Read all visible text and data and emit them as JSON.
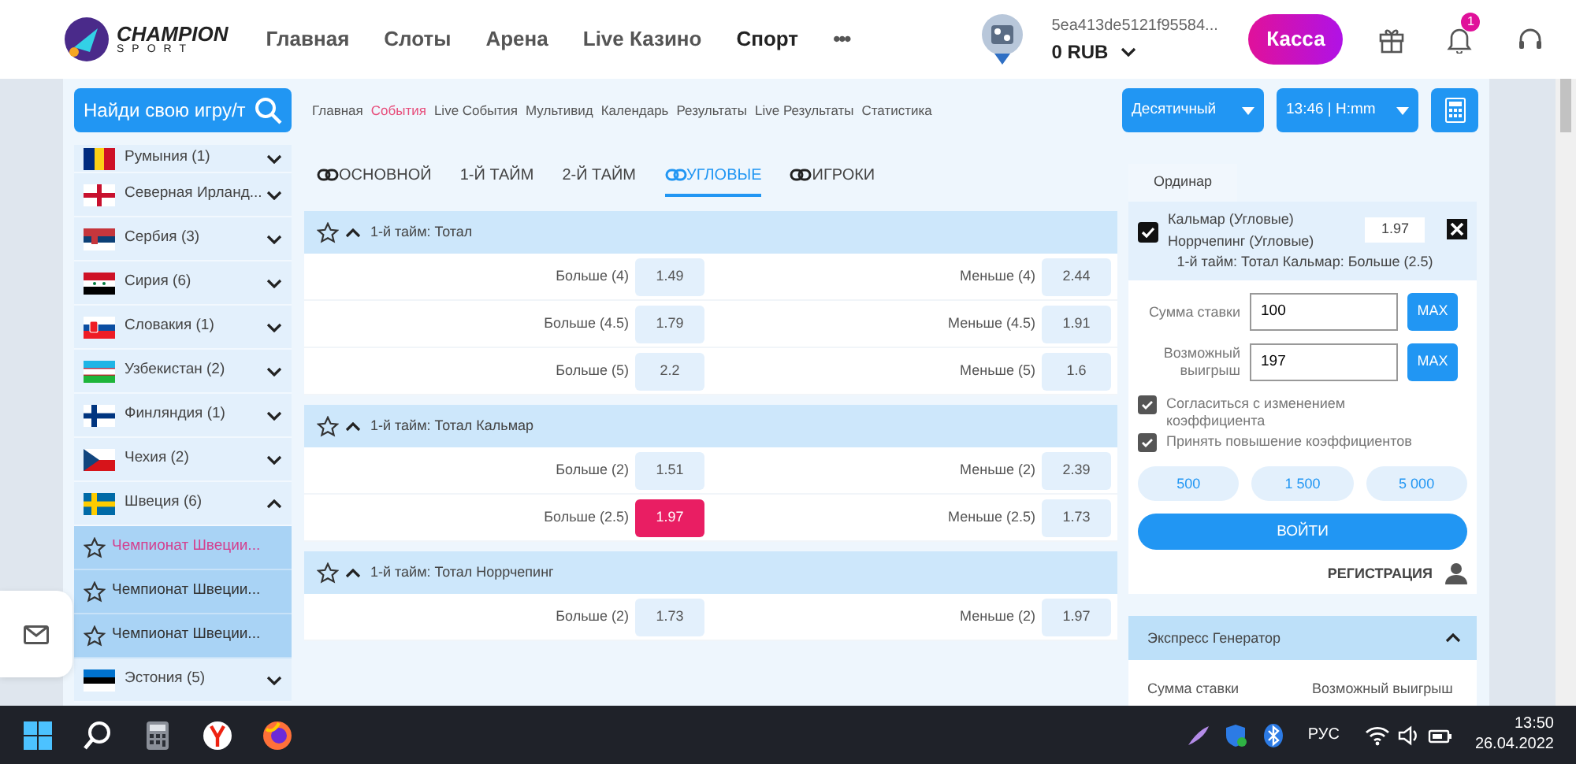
{
  "header": {
    "logo": {
      "title": "CHAMPION",
      "subtitle": "SPORT"
    },
    "nav": [
      {
        "label": "Главная",
        "selected": false
      },
      {
        "label": "Слоты",
        "selected": false
      },
      {
        "label": "Арена",
        "selected": false
      },
      {
        "label": "Live Казино",
        "selected": false
      },
      {
        "label": "Спорт",
        "selected": true
      }
    ],
    "more": "•••",
    "account": {
      "id": "5ea413de5121f95584...",
      "balance": "0 RUB"
    },
    "cashier": "Касса",
    "notifications": "1"
  },
  "subbar": {
    "search": "Найди свою игру/т",
    "links": [
      {
        "label": "Главная",
        "selected": false
      },
      {
        "label": "События",
        "selected": true
      },
      {
        "label": "Live События",
        "selected": false
      },
      {
        "label": "Мультивид",
        "selected": false
      },
      {
        "label": "Календарь",
        "selected": false
      },
      {
        "label": "Результаты",
        "selected": false
      },
      {
        "label": "Live Результаты",
        "selected": false
      },
      {
        "label": "Статистика",
        "selected": false
      }
    ],
    "odds_format": "Десятичный",
    "time_format": "13:46 | H:mm"
  },
  "sidebar": {
    "items": [
      {
        "label": "Румыния (1)",
        "expanded": false
      },
      {
        "label": "Северная Ирланд...",
        "expanded": false
      },
      {
        "label": "Сербия (3)",
        "expanded": false
      },
      {
        "label": "Сирия (6)",
        "expanded": false
      },
      {
        "label": "Словакия (1)",
        "expanded": false
      },
      {
        "label": "Узбекистан (2)",
        "expanded": false
      },
      {
        "label": "Финляндия (1)",
        "expanded": false
      },
      {
        "label": "Чехия (2)",
        "expanded": false
      },
      {
        "label": "Швеция (6)",
        "expanded": true,
        "children": [
          {
            "label": "Чемпионат Швеции...",
            "selected": true
          },
          {
            "label": "Чемпионат Швеции...",
            "selected": false
          },
          {
            "label": "Чемпионат Швеции...",
            "selected": false
          }
        ]
      },
      {
        "label": "Эстония (5)",
        "expanded": false
      }
    ]
  },
  "tabs": [
    {
      "label": "ОСНОВНОЙ",
      "kind": "linked",
      "selected": false
    },
    {
      "label": "1-Й ТАЙМ",
      "kind": "plain",
      "selected": false
    },
    {
      "label": "2-Й ТАЙМ",
      "kind": "plain",
      "selected": false
    },
    {
      "label": "УГЛОВЫЕ",
      "kind": "linked",
      "selected": true
    },
    {
      "label": "ИГРОКИ",
      "kind": "linked",
      "selected": false
    }
  ],
  "markets": [
    {
      "title": "1-й тайм: Тотал",
      "starred": false,
      "expanded": true,
      "rows": [
        [
          {
            "label": "Больше (4)",
            "odds": "1.49",
            "selected": false
          },
          {
            "label": "Меньше (4)",
            "odds": "2.44",
            "selected": false
          }
        ],
        [
          {
            "label": "Больше (4.5)",
            "odds": "1.79",
            "selected": false
          },
          {
            "label": "Меньше (4.5)",
            "odds": "1.91",
            "selected": false
          }
        ],
        [
          {
            "label": "Больше (5)",
            "odds": "2.2",
            "selected": false
          },
          {
            "label": "Меньше (5)",
            "odds": "1.6",
            "selected": false
          }
        ]
      ]
    },
    {
      "title": "1-й тайм: Тотал Кальмар",
      "starred": false,
      "expanded": true,
      "rows": [
        [
          {
            "label": "Больше (2)",
            "odds": "1.51",
            "selected": false
          },
          {
            "label": "Меньше (2)",
            "odds": "2.39",
            "selected": false
          }
        ],
        [
          {
            "label": "Больше (2.5)",
            "odds": "1.97",
            "selected": true
          },
          {
            "label": "Меньше (2.5)",
            "odds": "1.73",
            "selected": false
          }
        ]
      ]
    },
    {
      "title": "1-й тайм: Тотал Норрчепинг",
      "starred": false,
      "expanded": true,
      "rows": [
        [
          {
            "label": "Больше (2)",
            "odds": "1.73",
            "selected": false
          },
          {
            "label": "Меньше (2)",
            "odds": "1.97",
            "selected": false
          }
        ]
      ]
    }
  ],
  "betslip": {
    "tab": "Ординар",
    "selection": {
      "checked": true,
      "teams": [
        "Кальмар (Угловые)",
        "Норрчепинг (Угловые)"
      ],
      "odds": "1.97",
      "market": "1-й тайм: Тотал Кальмар: Больше (2.5)"
    },
    "fields": [
      {
        "label": "Сумма ставки",
        "value": "100",
        "button": "MAX"
      },
      {
        "label": "Возможный выигрыш",
        "value": "197",
        "button": "MAX"
      }
    ],
    "options": [
      {
        "label": "Согласиться с изменением коэффициента",
        "checked": true
      },
      {
        "label": "Принять повышение коэффициентов",
        "checked": true
      }
    ],
    "amounts": [
      "500",
      "1 500",
      "5 000"
    ],
    "login": "ВОЙТИ",
    "register": "РЕГИСТРАЦИЯ"
  },
  "express": {
    "title": "Экспресс Генератор",
    "expanded": true,
    "labels": [
      "Сумма ставки",
      "Возможный выигрыш"
    ]
  },
  "taskbar": {
    "language": "РУС",
    "time": "13:50",
    "date": "26.04.2022"
  }
}
